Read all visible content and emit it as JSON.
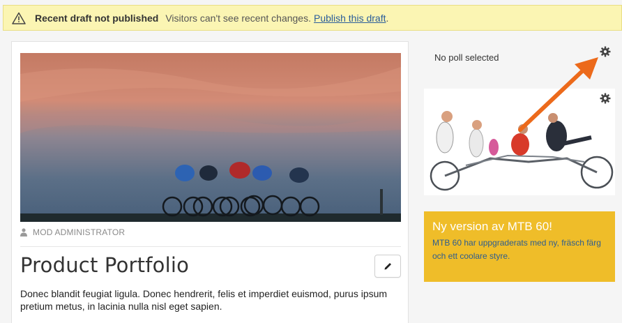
{
  "alert": {
    "title": "Recent draft not published",
    "text": "Visitors can't see recent changes.",
    "link": "Publish this draft",
    "punct": "."
  },
  "article": {
    "author": "MOD ADMINISTRATOR",
    "title": "Product Portfolio",
    "body": "Donec blandit feugiat ligula. Donec hendrerit, felis et imperdiet euismod, purus ipsum pretium metus, in lacinia nulla nisl eget sapien."
  },
  "sidebar": {
    "poll": "No poll selected",
    "promo_title": "Ny version av MTB 60!",
    "promo_text": "MTB 60 har uppgraderats med ny, fräsch färg och ett coolare styre."
  },
  "colors": {
    "alert_bg": "#fbf5b3",
    "promo_bg": "#efbd29",
    "link": "#2a5d9a",
    "arrow": "#ec6a1b"
  },
  "icons": [
    "warning-icon",
    "user-icon",
    "pencil-icon",
    "gear-icon"
  ]
}
